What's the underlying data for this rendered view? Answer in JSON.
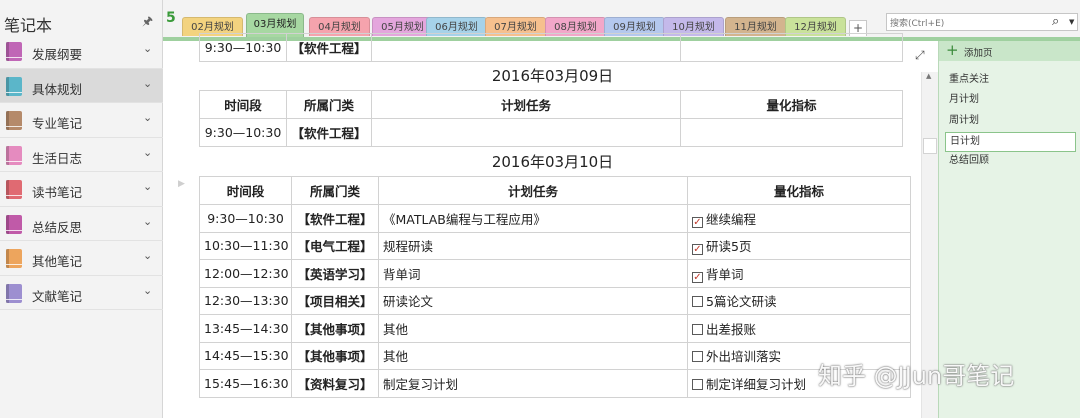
{
  "notebook": {
    "title": "笔记本",
    "items": [
      {
        "label": "发展纲要",
        "color": "#c066b6"
      },
      {
        "label": "具体规划",
        "color": "#5bb6c9"
      },
      {
        "label": "专业笔记",
        "color": "#b58a6a"
      },
      {
        "label": "生活日志",
        "color": "#e58bbf"
      },
      {
        "label": "读书笔记",
        "color": "#e06a72"
      },
      {
        "label": "总结反思",
        "color": "#c05aa8"
      },
      {
        "label": "其他笔记",
        "color": "#eda55d"
      },
      {
        "label": "文献笔记",
        "color": "#9d8fd0"
      }
    ],
    "active_index": 1
  },
  "section_group_back": "5",
  "tabs": [
    {
      "label": "02月规划",
      "color": "#f3d37f"
    },
    {
      "label": "03月规划",
      "color": "#a7d8a2"
    },
    {
      "label": "04月规划",
      "color": "#f5a3ad"
    },
    {
      "label": "05月规划",
      "color": "#e4a6dd"
    },
    {
      "label": "06月规划",
      "color": "#a6d2e9"
    },
    {
      "label": "07月规划",
      "color": "#f6c08e"
    },
    {
      "label": "08月规划",
      "color": "#f2a7c9"
    },
    {
      "label": "09月规划",
      "color": "#b4c8ee"
    },
    {
      "label": "10月规划",
      "color": "#c4b9ea"
    },
    {
      "label": "11月规划",
      "color": "#d3b48e"
    },
    {
      "label": "12月规划",
      "color": "#c9e29a"
    }
  ],
  "active_tab": 1,
  "add_tab": "+",
  "search": {
    "placeholder": "搜索(Ctrl+E)"
  },
  "tables": [
    {
      "date": "",
      "header": [],
      "rows": [
        {
          "time": "9:30—10:30",
          "dept": "【软件工程】",
          "task": "",
          "metric": "",
          "checked": null
        }
      ]
    },
    {
      "date": "2016年03月09日",
      "header": [
        "时间段",
        "所属门类",
        "计划任务",
        "量化指标"
      ],
      "rows": [
        {
          "time": "9:30—10:30",
          "dept": "【软件工程】",
          "task": "",
          "metric": "",
          "checked": null
        }
      ]
    },
    {
      "date": "2016年03月10日",
      "header": [
        "时间段",
        "所属门类",
        "计划任务",
        "量化指标"
      ],
      "rows": [
        {
          "time": "9:30—10:30",
          "dept": "【软件工程】",
          "task": "《MATLAB编程与工程应用》",
          "metric": "继续编程",
          "checked": true
        },
        {
          "time": "10:30—11:30",
          "dept": "【电气工程】",
          "task": "规程研读",
          "metric": "研读5页",
          "checked": true
        },
        {
          "time": "12:00—12:30",
          "dept": "【英语学习】",
          "task": "背单词",
          "metric": "背单词",
          "checked": true
        },
        {
          "time": "12:30—13:30",
          "dept": "【项目相关】",
          "task": "研读论文",
          "metric": "5篇论文研读",
          "checked": false
        },
        {
          "time": "13:45—14:30",
          "dept": "【其他事项】",
          "task": "其他",
          "metric": "出差报账",
          "checked": false
        },
        {
          "time": "14:45—15:30",
          "dept": "【其他事项】",
          "task": "其他",
          "metric": "外出培训落实",
          "checked": false
        },
        {
          "time": "15:45—16:30",
          "dept": "【资料复习】",
          "task": "制定复习计划",
          "metric": "制定详细复习计划",
          "checked": false
        }
      ]
    }
  ],
  "pages": {
    "add_label": "添加页",
    "items": [
      "重点关注",
      "月计划",
      "周计划",
      "日计划",
      "总结回顾"
    ],
    "active_index": 3
  },
  "watermark": "知乎 @JJun哥笔记"
}
